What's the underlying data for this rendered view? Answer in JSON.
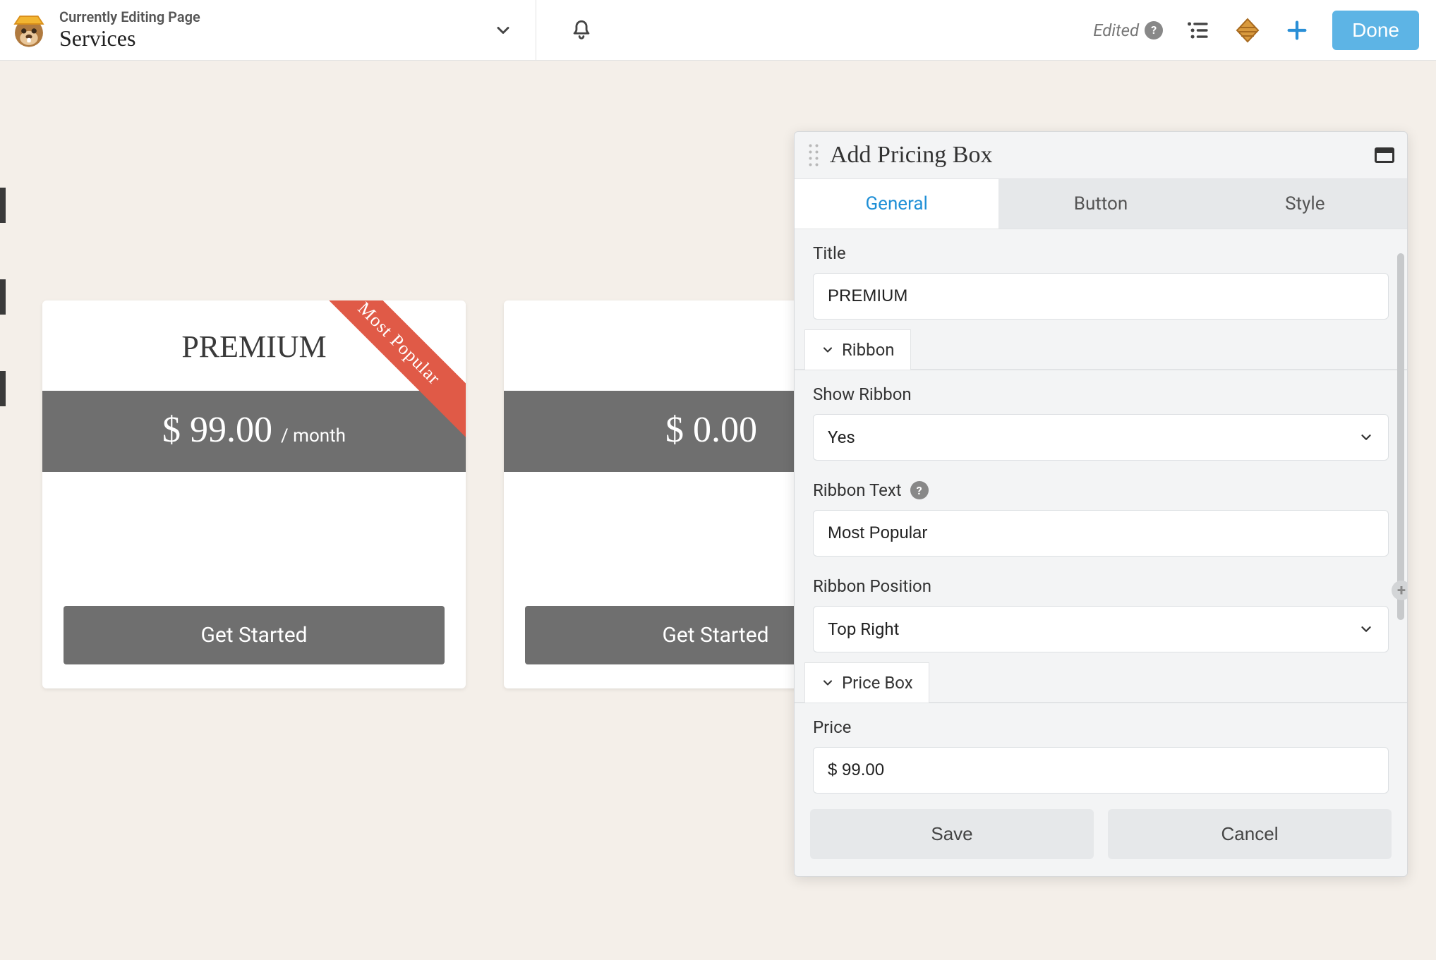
{
  "header": {
    "editing_label": "Currently Editing Page",
    "page_title": "Services",
    "edited_label": "Edited",
    "done_label": "Done"
  },
  "cards": [
    {
      "title": "PREMIUM",
      "price": "$ 99.00",
      "suffix": "/ month",
      "button": "Get Started",
      "ribbon": "Most Popular"
    },
    {
      "title": "",
      "price": "$ 0.00",
      "suffix": "",
      "button": "Get Started",
      "ribbon": ""
    }
  ],
  "panel": {
    "title": "Add Pricing Box",
    "tabs": [
      "General",
      "Button",
      "Style"
    ],
    "active_tab": 0,
    "sections": {
      "title": {
        "label": "Title",
        "value": "PREMIUM"
      },
      "ribbon": {
        "heading": "Ribbon",
        "show_label": "Show Ribbon",
        "show_value": "Yes",
        "text_label": "Ribbon Text",
        "text_value": "Most Popular",
        "position_label": "Ribbon Position",
        "position_value": "Top Right"
      },
      "pricebox": {
        "heading": "Price Box",
        "price_label": "Price",
        "price_value": "$ 99.00"
      }
    },
    "footer": {
      "save": "Save",
      "cancel": "Cancel"
    }
  }
}
